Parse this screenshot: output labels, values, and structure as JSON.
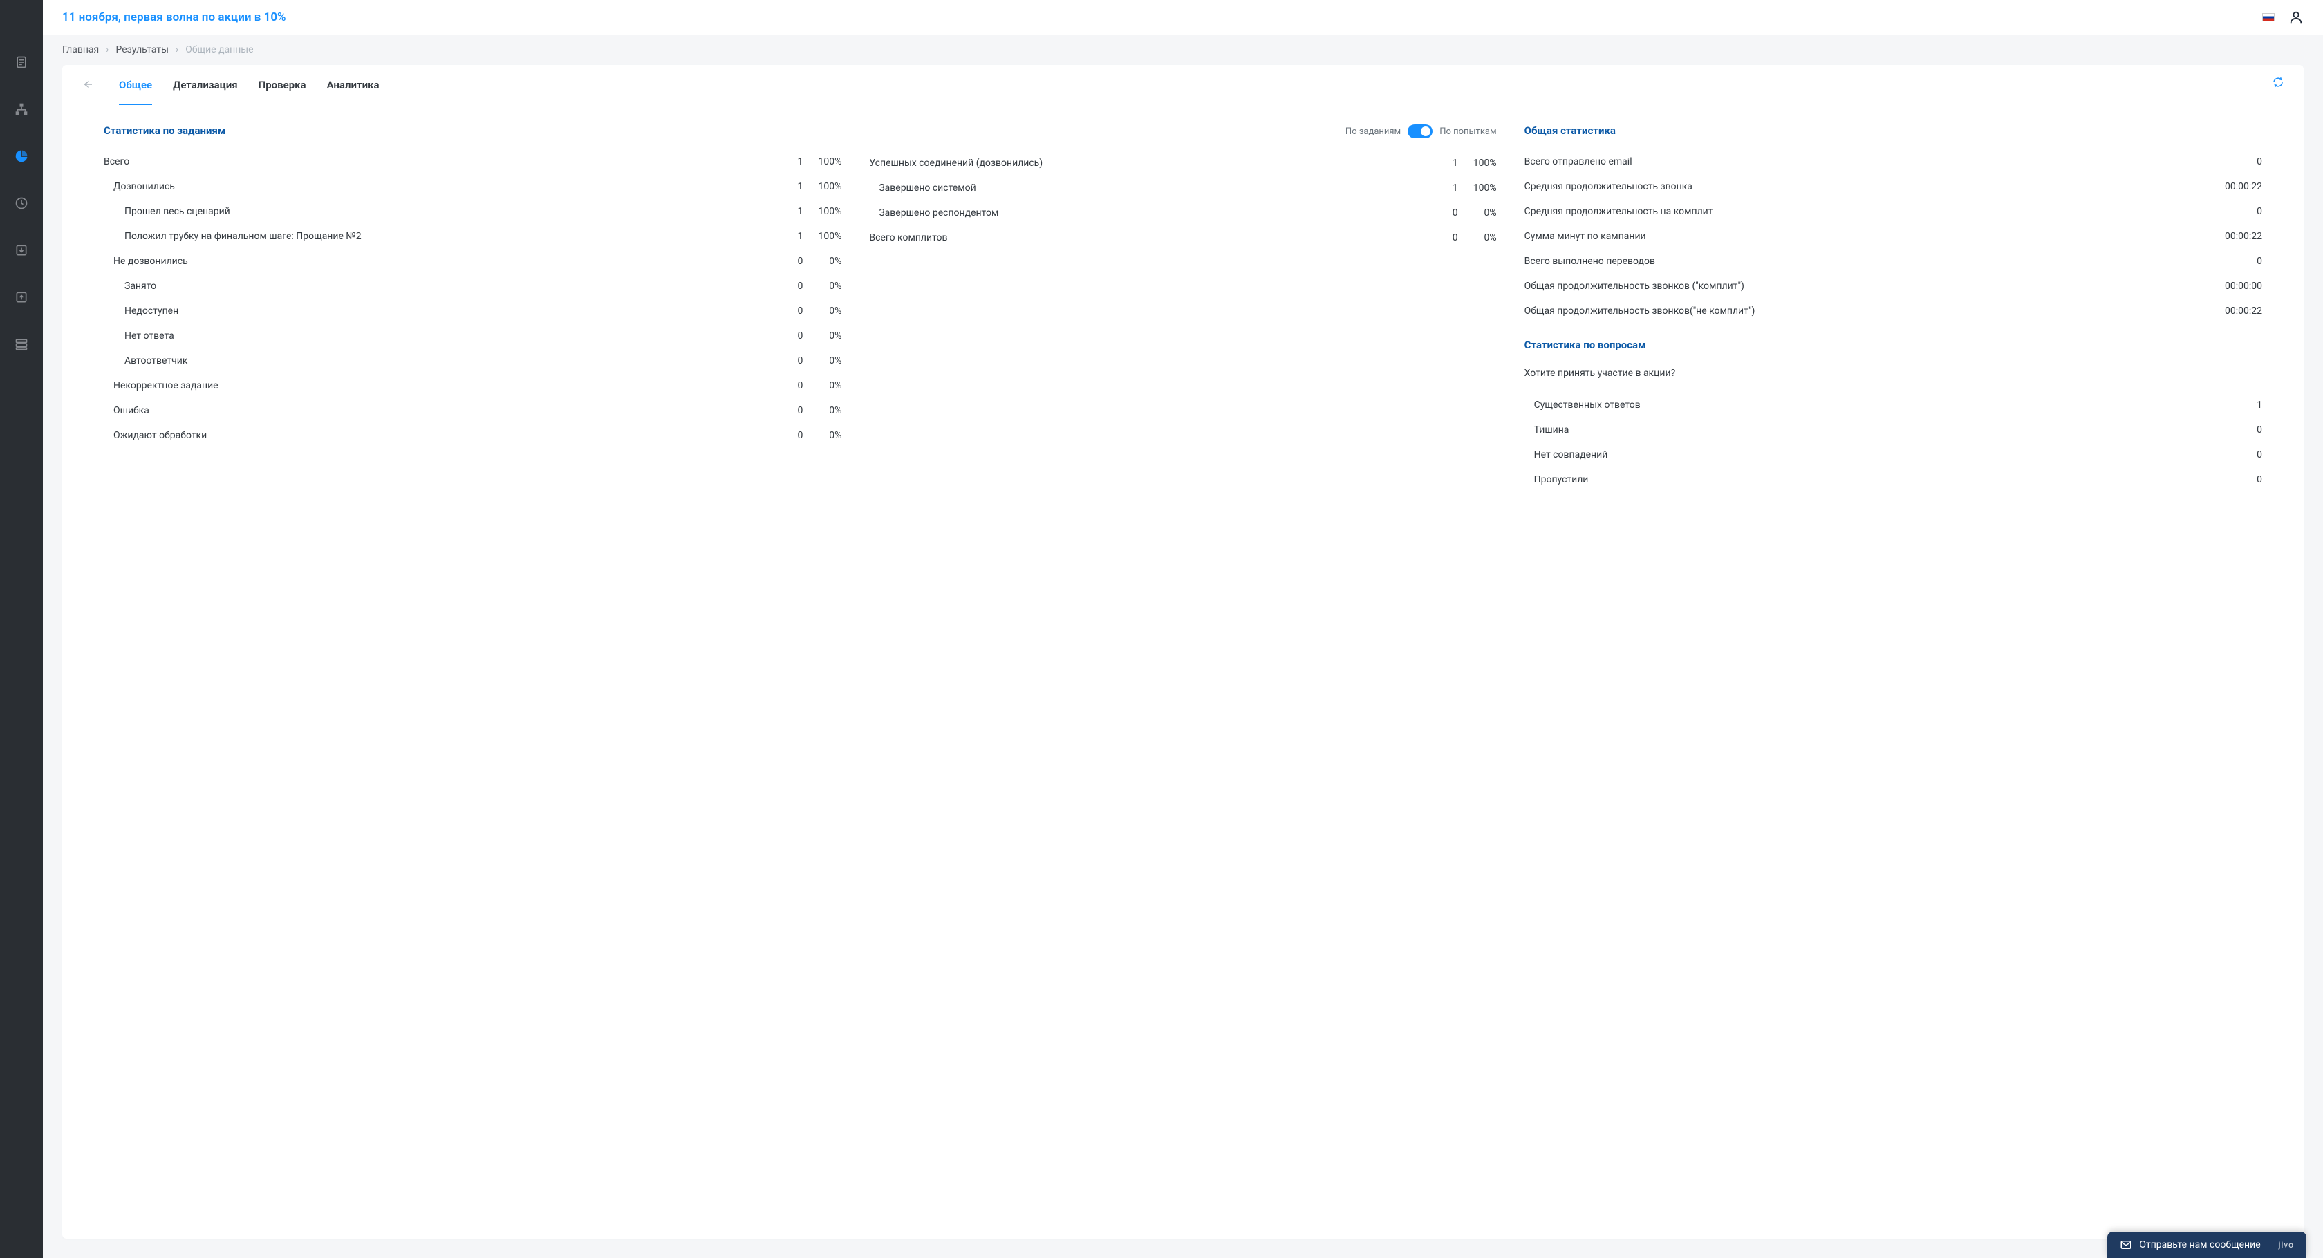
{
  "header": {
    "title": "11 ноября, первая волна по акции в 10%"
  },
  "breadcrumb": {
    "items": [
      "Главная",
      "Результаты",
      "Общие данные"
    ]
  },
  "tabs": {
    "items": [
      "Общее",
      "Детализация",
      "Проверка",
      "Аналитика"
    ],
    "active": 0
  },
  "toggle": {
    "left_label": "По заданиям",
    "right_label": "По попыткам"
  },
  "sections": {
    "task_stats_title": "Статистика по заданиям",
    "general_stats_title": "Общая статистика",
    "question_stats_title": "Статистика по вопросам"
  },
  "task_stats": [
    {
      "label": "Всего",
      "count": "1",
      "pct": "100%",
      "indent": 0
    },
    {
      "label": "Дозвонились",
      "count": "1",
      "pct": "100%",
      "indent": 1
    },
    {
      "label": "Прошел весь сценарий",
      "count": "1",
      "pct": "100%",
      "indent": 2
    },
    {
      "label": "Положил трубку на финальном шаге: Прощание №2",
      "count": "1",
      "pct": "100%",
      "indent": 2
    },
    {
      "label": "Не дозвонились",
      "count": "0",
      "pct": "0%",
      "indent": 1
    },
    {
      "label": "Занято",
      "count": "0",
      "pct": "0%",
      "indent": 2
    },
    {
      "label": "Недоступен",
      "count": "0",
      "pct": "0%",
      "indent": 2
    },
    {
      "label": "Нет ответа",
      "count": "0",
      "pct": "0%",
      "indent": 2
    },
    {
      "label": "Автоответчик",
      "count": "0",
      "pct": "0%",
      "indent": 2
    },
    {
      "label": "Некорректное задание",
      "count": "0",
      "pct": "0%",
      "indent": 1
    },
    {
      "label": "Ошибка",
      "count": "0",
      "pct": "0%",
      "indent": 1
    },
    {
      "label": "Ожидают обработки",
      "count": "0",
      "pct": "0%",
      "indent": 1
    }
  ],
  "conn_stats": [
    {
      "label": "Успешных соединений (дозвонились)",
      "count": "1",
      "pct": "100%",
      "indent": 0
    },
    {
      "label": "Завершено системой",
      "count": "1",
      "pct": "100%",
      "indent": 1
    },
    {
      "label": "Завершено респондентом",
      "count": "0",
      "pct": "0%",
      "indent": 1
    },
    {
      "label": "Всего комплитов",
      "count": "0",
      "pct": "0%",
      "indent": 0
    }
  ],
  "general_stats": [
    {
      "label": "Всего отправлено email",
      "value": "0"
    },
    {
      "label": "Средняя продолжительность звонка",
      "value": "00:00:22"
    },
    {
      "label": "Средняя продолжительность на комплит",
      "value": "0"
    },
    {
      "label": "Сумма минут по кампании",
      "value": "00:00:22"
    },
    {
      "label": "Всего выполнено переводов",
      "value": "0"
    },
    {
      "label": "Общая продолжительность звонков (\"комплит\")",
      "value": "00:00:00"
    },
    {
      "label": "Общая продолжительность звонков(\"не комплит\")",
      "value": "00:00:22"
    }
  ],
  "question": {
    "text": "Хотите принять участие в акции?",
    "answers": [
      {
        "label": "Существенных ответов",
        "value": "1"
      },
      {
        "label": "Тишина",
        "value": "0"
      },
      {
        "label": "Нет совпадений",
        "value": "0"
      },
      {
        "label": "Пропустили",
        "value": "0"
      }
    ]
  },
  "jivo": {
    "text": "Отправьте нам сообщение",
    "brand": "jivo"
  }
}
